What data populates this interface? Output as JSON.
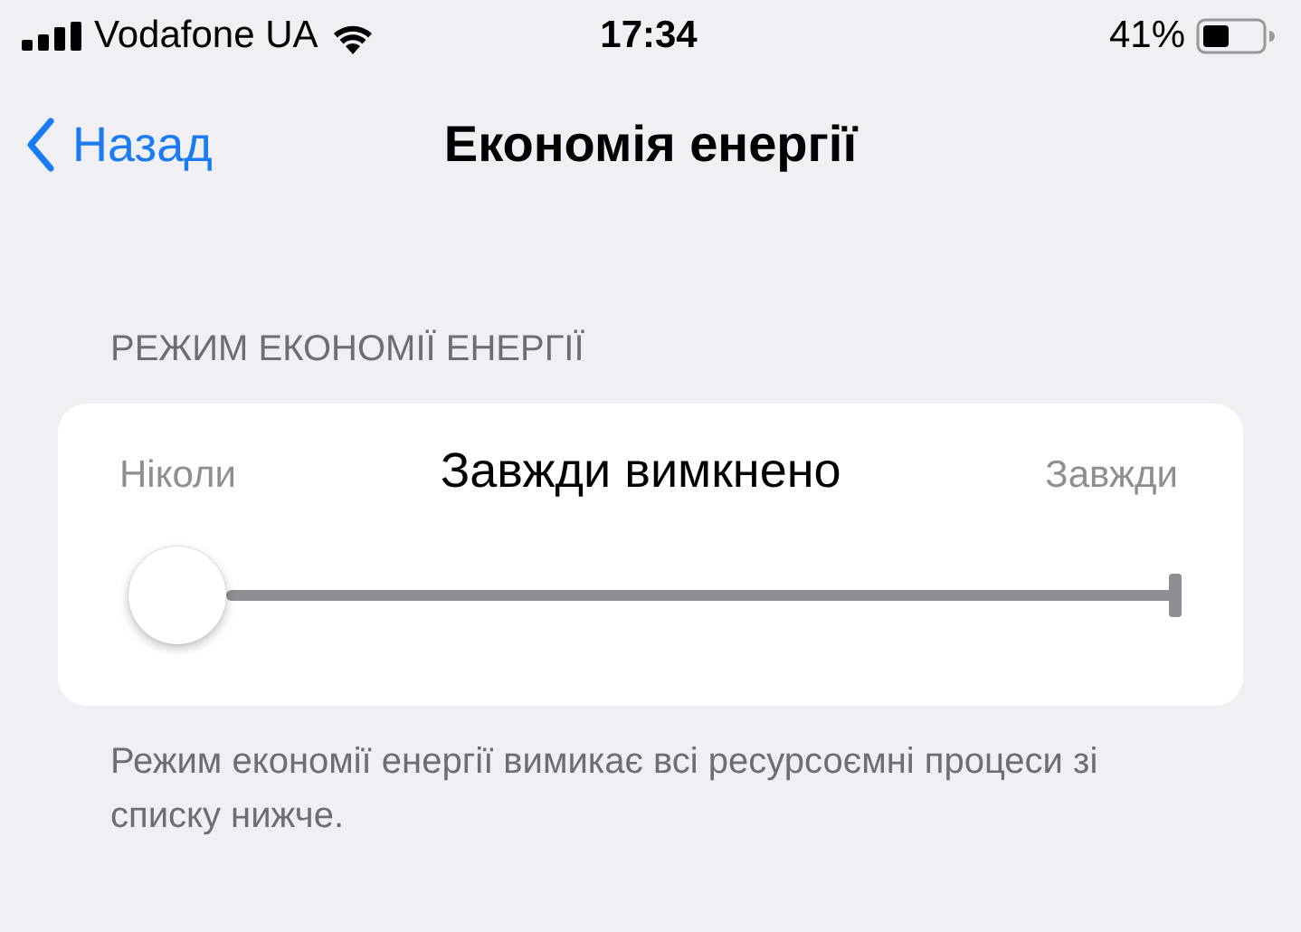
{
  "status_bar": {
    "carrier": "Vodafone UA",
    "time": "17:34",
    "battery": "41%"
  },
  "nav_bar": {
    "back": "Назад",
    "title": "Економія енергії"
  },
  "section": {
    "header": "РЕЖИМ ЕКОНОМІЇ ЕНЕРГІЇ",
    "slider": {
      "min_label": "Ніколи",
      "value_label": "Завжди вимкнено",
      "max_label": "Завжди",
      "level": 0
    },
    "footer": "Режим економії енергії вимикає всі ресурсоємні процеси зі списку нижче."
  }
}
